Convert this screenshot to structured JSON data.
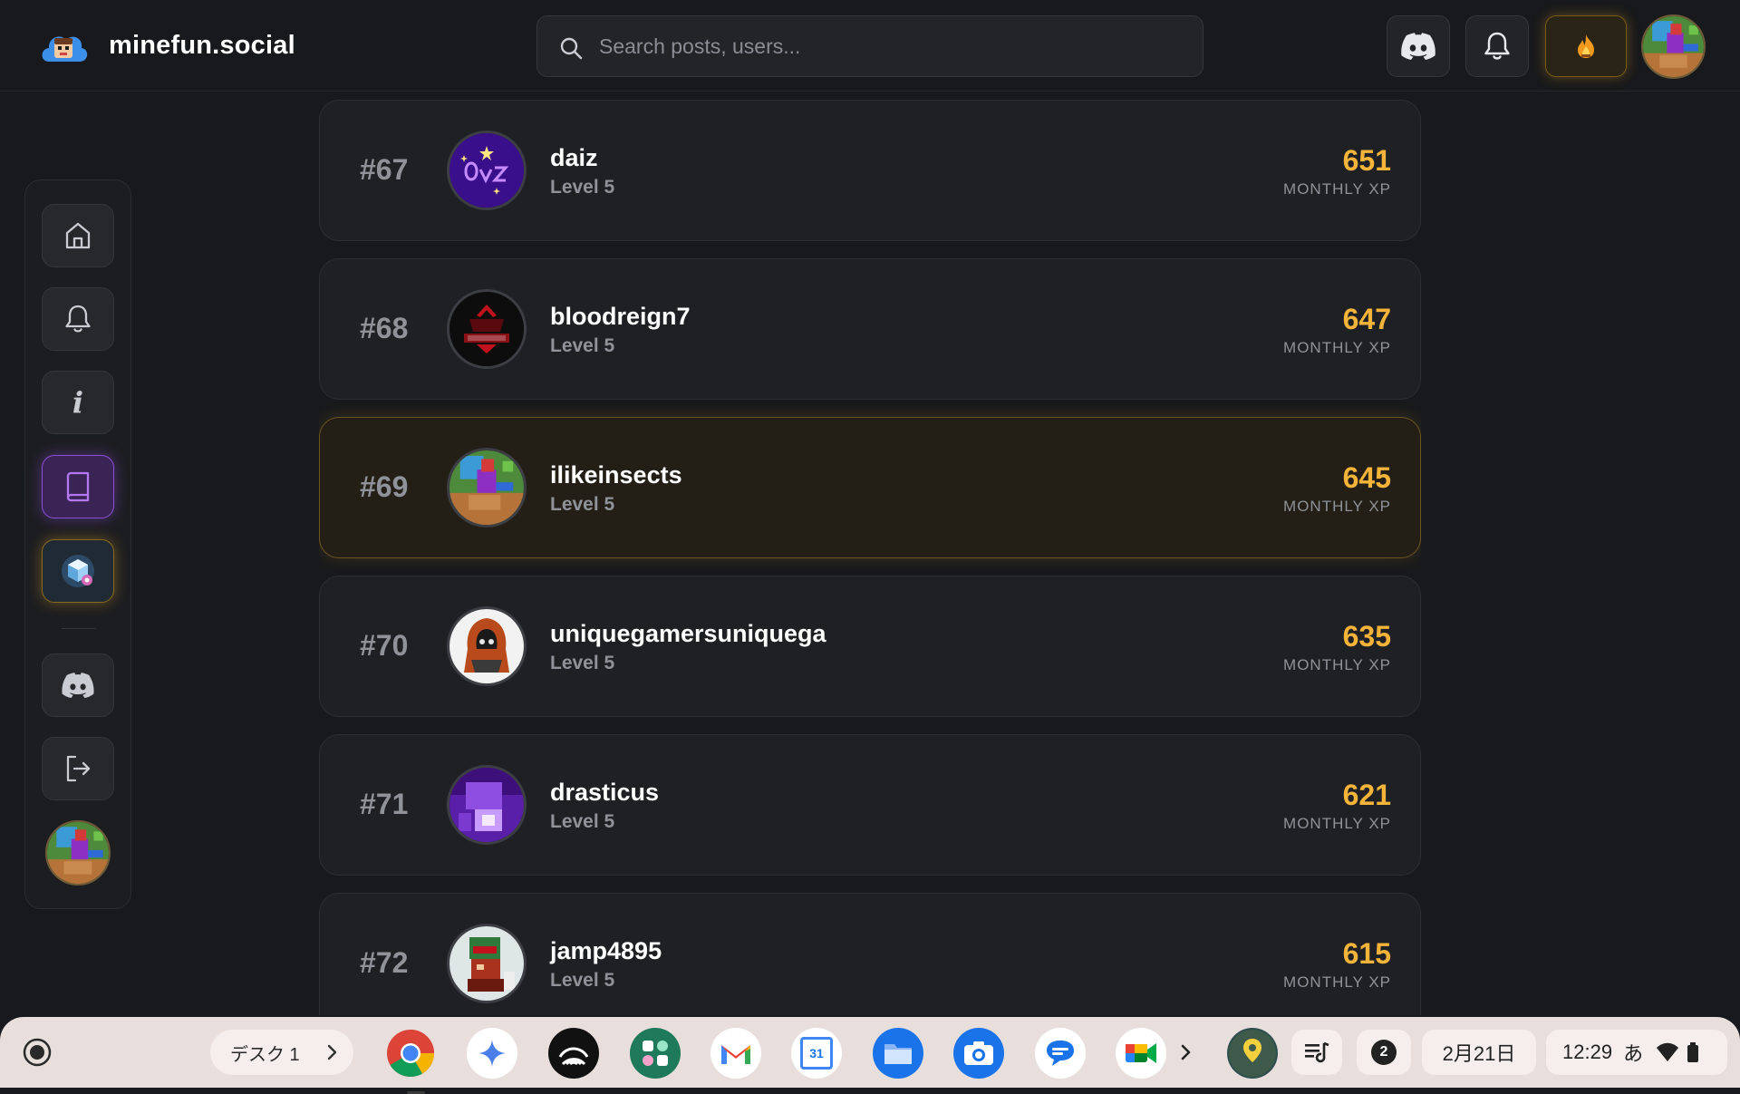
{
  "header": {
    "site_name": "minefun.social",
    "search_placeholder": "Search posts, users...",
    "streak_icon": "fire-icon"
  },
  "sidebar": {
    "items": [
      {
        "name": "home",
        "icon": "home-icon"
      },
      {
        "name": "notifications",
        "icon": "bell-icon"
      },
      {
        "name": "info",
        "icon": "info-icon",
        "glyph": "i"
      },
      {
        "name": "guide",
        "icon": "book-icon",
        "active": true
      },
      {
        "name": "game",
        "icon": "cube-icon"
      },
      {
        "name": "discord",
        "icon": "discord-icon"
      },
      {
        "name": "logout",
        "icon": "logout-icon"
      }
    ]
  },
  "leaderboard": {
    "xp_label": "MONTHLY XP",
    "rows": [
      {
        "rank": "#67",
        "name": "daiz",
        "level": "Level 5",
        "xp": "651"
      },
      {
        "rank": "#68",
        "name": "bloodreign7",
        "level": "Level 5",
        "xp": "647"
      },
      {
        "rank": "#69",
        "name": "ilikeinsects",
        "level": "Level 5",
        "xp": "645",
        "highlight": true
      },
      {
        "rank": "#70",
        "name": "uniquegamersuniquega",
        "level": "Level 5",
        "xp": "635"
      },
      {
        "rank": "#71",
        "name": "drasticus",
        "level": "Level 5",
        "xp": "621"
      },
      {
        "rank": "#72",
        "name": "jamp4895",
        "level": "Level 5",
        "xp": "615"
      }
    ]
  },
  "taskbar": {
    "desk_label": "デスク 1",
    "apps": [
      "Chrome",
      "Gemini",
      "Podcasts",
      "App Grid",
      "Gmail",
      "Calendar",
      "Files",
      "Camera",
      "Messages",
      "Meet"
    ],
    "calendar_day": "31",
    "notification_count": "2",
    "date": "2月21日",
    "time": "12:29",
    "ime": "あ"
  },
  "colors": {
    "accent_xp": "#f4b43a",
    "accent_purple": "#8b4fd6",
    "highlight_border": "#6b5420"
  }
}
